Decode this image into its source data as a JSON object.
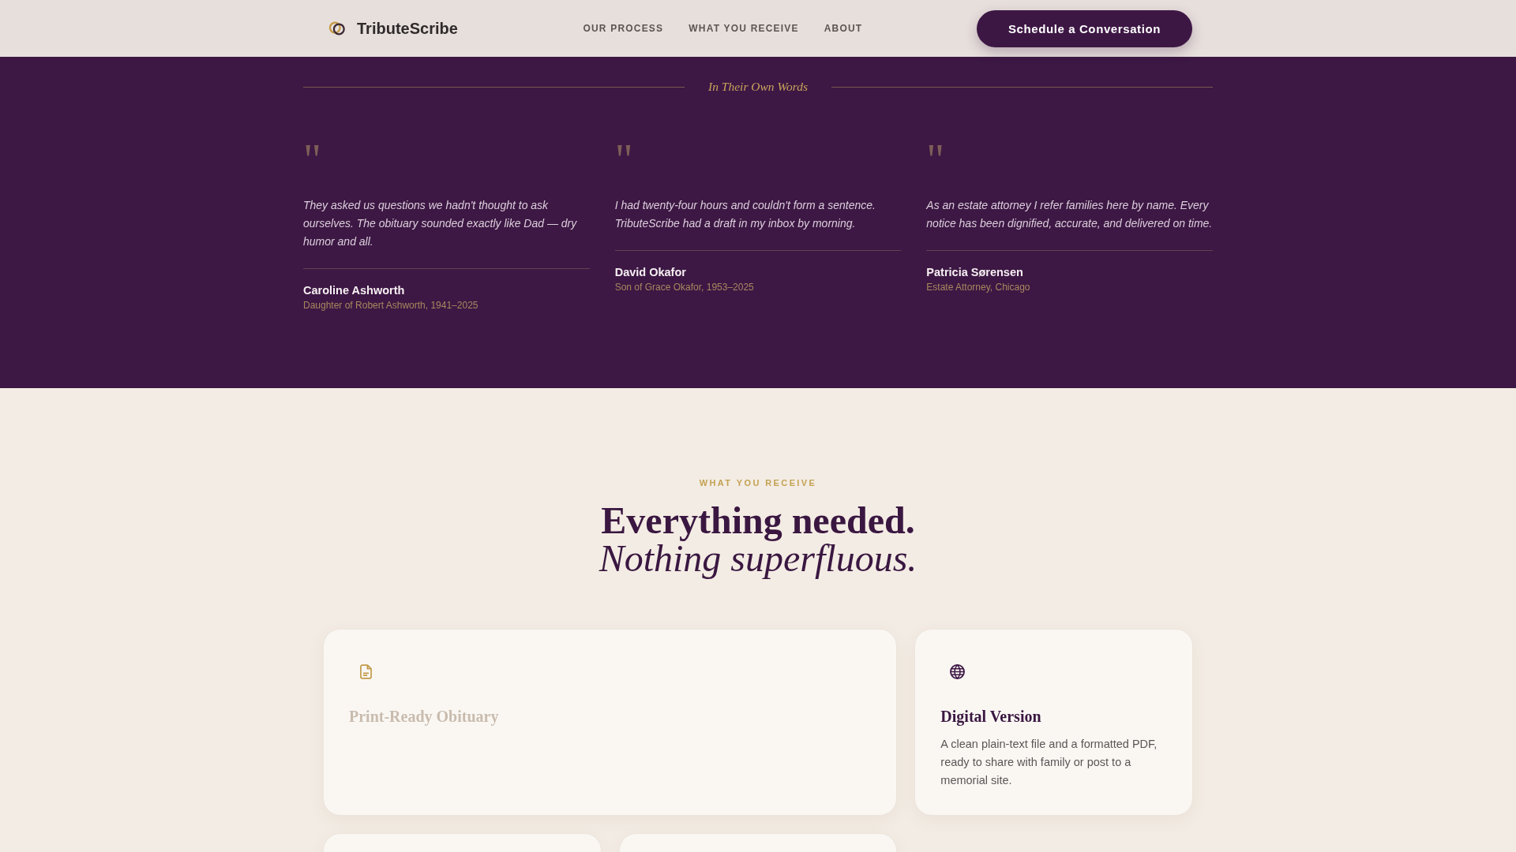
{
  "header": {
    "brand": "TributeScribe",
    "nav": [
      "OUR PROCESS",
      "WHAT YOU RECEIVE",
      "ABOUT"
    ],
    "cta": "Schedule a Conversation"
  },
  "testimonials": {
    "title": "In Their Own Words",
    "items": [
      {
        "mark": "\"",
        "quote": "They asked us questions we hadn't thought to ask ourselves. The obituary sounded exactly like Dad — dry humor and all.",
        "name": "Caroline Ashworth",
        "role": "Daughter of Robert Ashworth, 1941–2025"
      },
      {
        "mark": "\"",
        "quote": "I had twenty-four hours and couldn't form a sentence. TributeScribe had a draft in my inbox by morning.",
        "name": "David Okafor",
        "role": "Son of Grace Okafor, 1953–2025"
      },
      {
        "mark": "\"",
        "quote": "As an estate attorney I refer families here by name. Every notice has been dignified, accurate, and delivered on time.",
        "name": "Patricia Sørensen",
        "role": "Estate Attorney, Chicago"
      }
    ]
  },
  "features": {
    "eyebrow": "WHAT YOU RECEIVE",
    "title": "Everything needed.",
    "title_emphasis": "Nothing superfluous.",
    "cards": [
      {
        "title": "Print-Ready Obituary",
        "faded": true
      },
      {
        "title": "Digital Version",
        "description": "A clean plain-text file and a formatted PDF, ready to share with family or post to a memorial site.",
        "faded": false
      }
    ]
  }
}
